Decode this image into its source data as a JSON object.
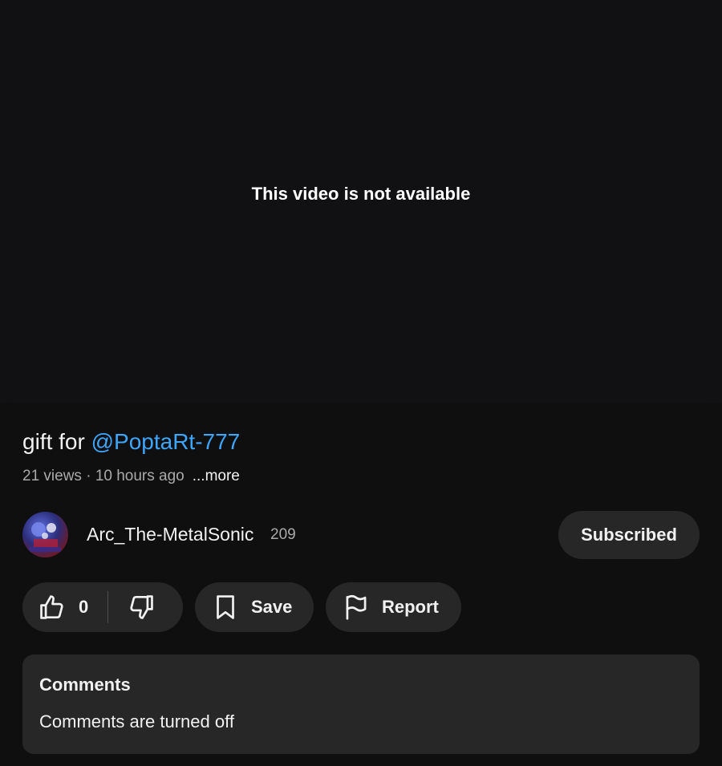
{
  "player": {
    "message": "This video is not available"
  },
  "video": {
    "title_prefix": "gift for ",
    "title_mention": "@PoptaRt-777",
    "views": "21 views",
    "separator": " · ",
    "age": "10 hours ago",
    "more_label": "...more"
  },
  "channel": {
    "name": "Arc_The-MetalSonic",
    "subscriber_count": "209",
    "subscribe_label": "Subscribed"
  },
  "actions": {
    "like_count": "0",
    "save_label": "Save",
    "report_label": "Report"
  },
  "comments": {
    "title": "Comments",
    "status": "Comments are turned off"
  },
  "icons": {
    "like": "thumbs-up-icon",
    "dislike": "thumbs-down-icon",
    "save": "bookmark-icon",
    "report": "flag-icon"
  },
  "colors": {
    "background": "#0f0f0f",
    "surface": "#272727",
    "mention": "#3ea6ff",
    "secondary_text": "#aaaaaa"
  }
}
